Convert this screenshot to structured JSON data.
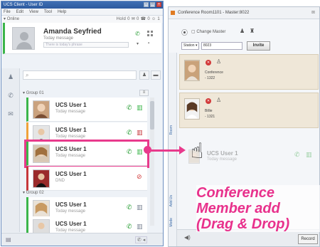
{
  "client": {
    "title": "UCS Client - User ID",
    "menu": [
      "File",
      "Edit",
      "View",
      "Tool",
      "Help"
    ],
    "status": "Online",
    "stats": "Hold 0   ✉ 0   ☎ 0   ☺ 1",
    "profile": {
      "name": "Amanda Seyfried",
      "message": "Today message",
      "input_placeholder": "There is today's phrase"
    },
    "groups": [
      {
        "label": "Group 01",
        "members": [
          {
            "name": "UCS User 1",
            "message": "Today message",
            "status": "green"
          },
          {
            "name": "UCS User 1",
            "message": "Today message",
            "status": "orange"
          },
          {
            "name": "UCS User 1",
            "message": "Today message",
            "status": "green",
            "selected": true
          },
          {
            "name": "UCS User 1",
            "message": "DND",
            "status": "red"
          }
        ]
      },
      {
        "label": "Group 02",
        "members": [
          {
            "name": "UCS User 1",
            "message": "Today message",
            "status": "green"
          },
          {
            "name": "UCS User 1",
            "message": "Today message",
            "status": "green"
          }
        ]
      }
    ]
  },
  "conference": {
    "title": "Conference Room1101 - Master:8022",
    "change_master": "Change Master",
    "station_label": "Station",
    "number_value": "8023",
    "invite_label": "Invite",
    "side_label": "Room",
    "side_label2": "Add Us",
    "side_label3": "Mode",
    "members": [
      {
        "label": "Conference",
        "ext": "- 1322"
      },
      {
        "label": "Billie",
        "ext": "- 1321"
      }
    ],
    "drag_item": {
      "name": "UCS User 1",
      "message": "Today message"
    },
    "record_label": "Record"
  },
  "annotation": [
    "Conference",
    "Member add",
    "(Drag & Drop)"
  ],
  "colors": {
    "accent": "#e8318c",
    "online": "#3bb54a",
    "away": "#f0a23a",
    "busy": "#c6373b",
    "titlebar": "#3f6fb4"
  }
}
